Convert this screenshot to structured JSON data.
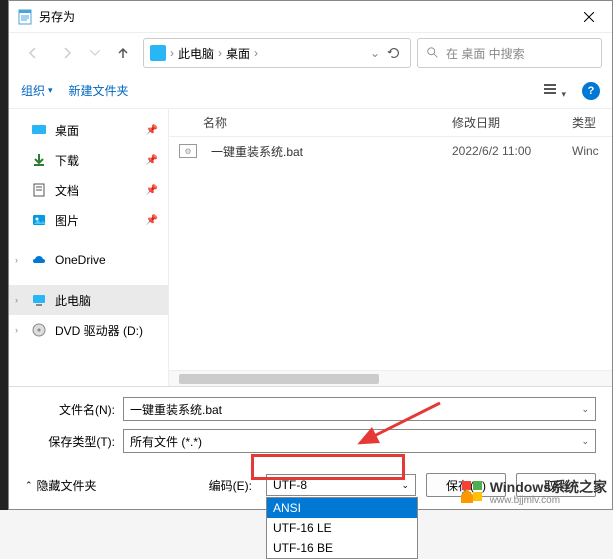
{
  "window": {
    "title": "另存为"
  },
  "breadcrumb": {
    "seg1": "此电脑",
    "seg2": "桌面"
  },
  "search": {
    "placeholder": "在 桌面 中搜索"
  },
  "toolbar": {
    "organize": "组织",
    "newfolder": "新建文件夹"
  },
  "sidebar": {
    "items": [
      {
        "label": "桌面",
        "icon": "desktop"
      },
      {
        "label": "下载",
        "icon": "download"
      },
      {
        "label": "文档",
        "icon": "document"
      },
      {
        "label": "图片",
        "icon": "pictures"
      },
      {
        "label": "OneDrive",
        "icon": "onedrive"
      },
      {
        "label": "此电脑",
        "icon": "thispc"
      },
      {
        "label": "DVD 驱动器 (D:)",
        "icon": "dvd"
      }
    ]
  },
  "columns": {
    "name": "名称",
    "date": "修改日期",
    "type": "类型"
  },
  "files": [
    {
      "name": "一键重装系统.bat",
      "date": "2022/6/2 11:00",
      "type": "Winc"
    }
  ],
  "form": {
    "filename_label": "文件名(N):",
    "filename_value": "一键重装系统.bat",
    "savetype_label": "保存类型(T):",
    "savetype_value": "所有文件 (*.*)"
  },
  "footer": {
    "hide": "隐藏文件夹",
    "encoding_label": "编码(E):",
    "encoding_value": "UTF-8",
    "save": "保存(S)",
    "cancel": "取消",
    "options": [
      "ANSI",
      "UTF-16 LE",
      "UTF-16 BE"
    ]
  },
  "watermark": {
    "text": "Windows系统之家",
    "sub": "www.bjjmlv.com"
  }
}
